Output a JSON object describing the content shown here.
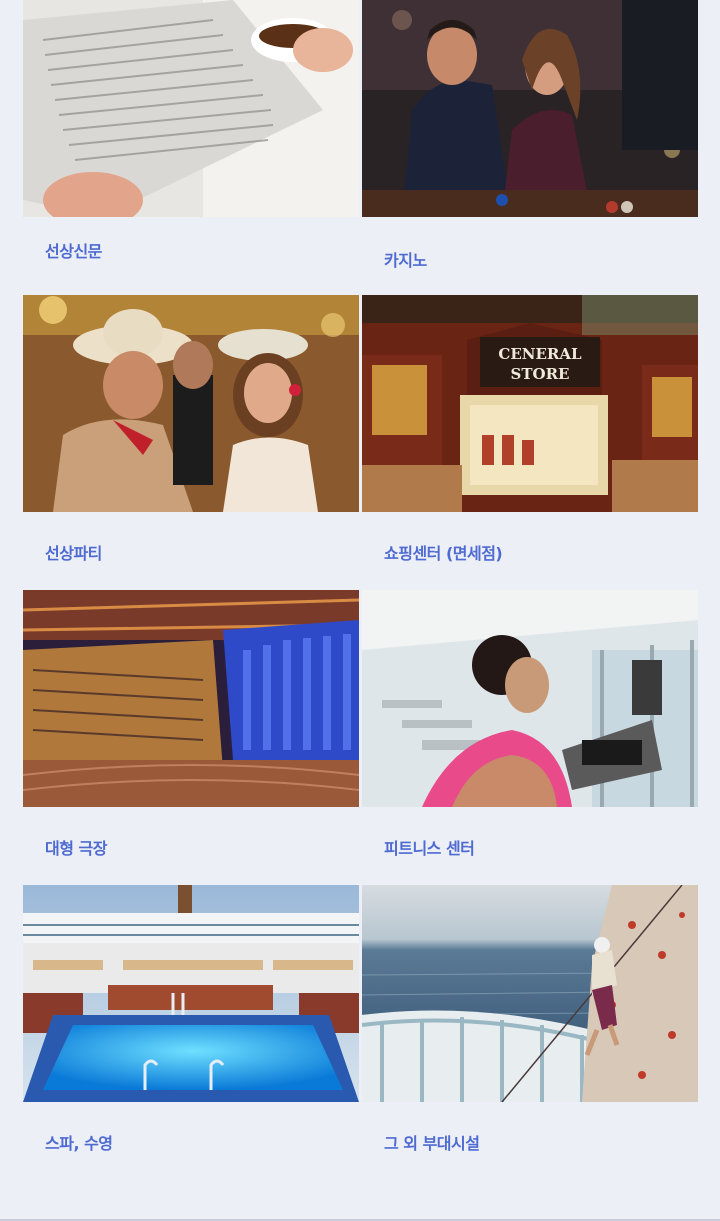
{
  "facilities": [
    {
      "label": "선상신문",
      "image": "newspaper-photo"
    },
    {
      "label": "카지노",
      "image": "casino-photo"
    },
    {
      "label": "선상파티",
      "image": "party-photo"
    },
    {
      "label": "쇼핑센터 (면세점)",
      "image": "shopping-store-photo"
    },
    {
      "label": "대형 극장",
      "image": "theater-photo"
    },
    {
      "label": "피트니스 센터",
      "image": "fitness-photo"
    },
    {
      "label": "스파, 수영",
      "image": "pool-photo"
    },
    {
      "label": "그 외 부대시설",
      "image": "rock-climbing-photo"
    }
  ]
}
